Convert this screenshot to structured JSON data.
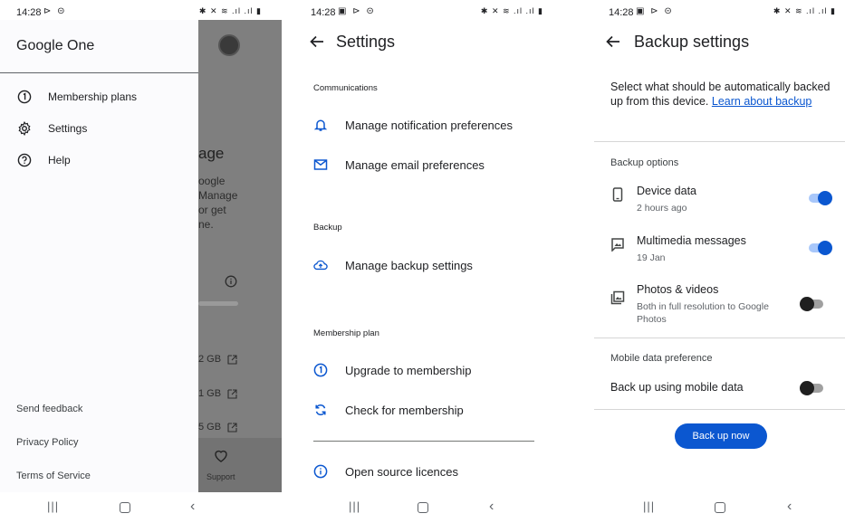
{
  "screens": [
    {
      "status": {
        "time": "14:28",
        "left_icons": "⊳ ⊝",
        "right_icons": "✱ ✕ ≋ .ıl .ıl ▮"
      },
      "app_title": "Google One",
      "menu": [
        {
          "label": "Membership plans",
          "icon": "membership-icon"
        },
        {
          "label": "Settings",
          "icon": "gear-icon"
        },
        {
          "label": "Help",
          "icon": "help-icon"
        }
      ],
      "footer_links": [
        "Send feedback",
        "Privacy Policy",
        "Terms of Service"
      ],
      "background": {
        "heading_fragment": "age",
        "text_fragments": [
          "oogle",
          "Manage",
          "or get",
          "ne."
        ],
        "storage_fragments": [
          "2 GB",
          "1 GB",
          "5 GB"
        ],
        "support_label": "Support"
      }
    },
    {
      "status": {
        "time": "14:28",
        "left_icons": "▣ ⊳ ⊝",
        "right_icons": "✱ ✕ ≋ .ıl .ıl ▮"
      },
      "title": "Settings",
      "sections": {
        "communications": {
          "header": "Communications",
          "items": [
            {
              "label": "Manage notification preferences",
              "icon": "bell-icon"
            },
            {
              "label": "Manage email preferences",
              "icon": "email-icon"
            }
          ]
        },
        "backup": {
          "header": "Backup",
          "items": [
            {
              "label": "Manage backup settings",
              "icon": "cloud-upload-icon"
            }
          ]
        },
        "membership": {
          "header": "Membership plan",
          "items": [
            {
              "label": "Upgrade to membership",
              "icon": "membership-icon"
            },
            {
              "label": "Check for membership",
              "icon": "refresh-icon"
            }
          ]
        },
        "other": {
          "items": [
            {
              "label": "Open source licences",
              "icon": "info-icon"
            }
          ]
        }
      }
    },
    {
      "status": {
        "time": "14:28",
        "left_icons": "▣ ⊳ ⊝",
        "right_icons": "✱ ✕ ≋ .ıl .ıl ▮"
      },
      "title": "Backup settings",
      "intro_text": "Select what should be automatically backed up from this device.",
      "intro_link": "Learn about backup",
      "backup_options_header": "Backup options",
      "options": [
        {
          "title": "Device data",
          "subtitle": "2 hours ago",
          "enabled": true,
          "icon": "phone-icon"
        },
        {
          "title": "Multimedia messages",
          "subtitle": "19 Jan",
          "enabled": true,
          "icon": "image-message-icon"
        },
        {
          "title": "Photos & videos",
          "subtitle": "Both in full resolution to Google Photos",
          "enabled": false,
          "icon": "photo-library-icon"
        }
      ],
      "mobile_data_header": "Mobile data preference",
      "mobile_data": {
        "label": "Back up using mobile data",
        "enabled": false
      },
      "button_label": "Back up now"
    }
  ],
  "colors": {
    "accent": "#0b57d0",
    "toggle_on_track": "#a8c7fa",
    "scrim": "#7f7f7f"
  }
}
